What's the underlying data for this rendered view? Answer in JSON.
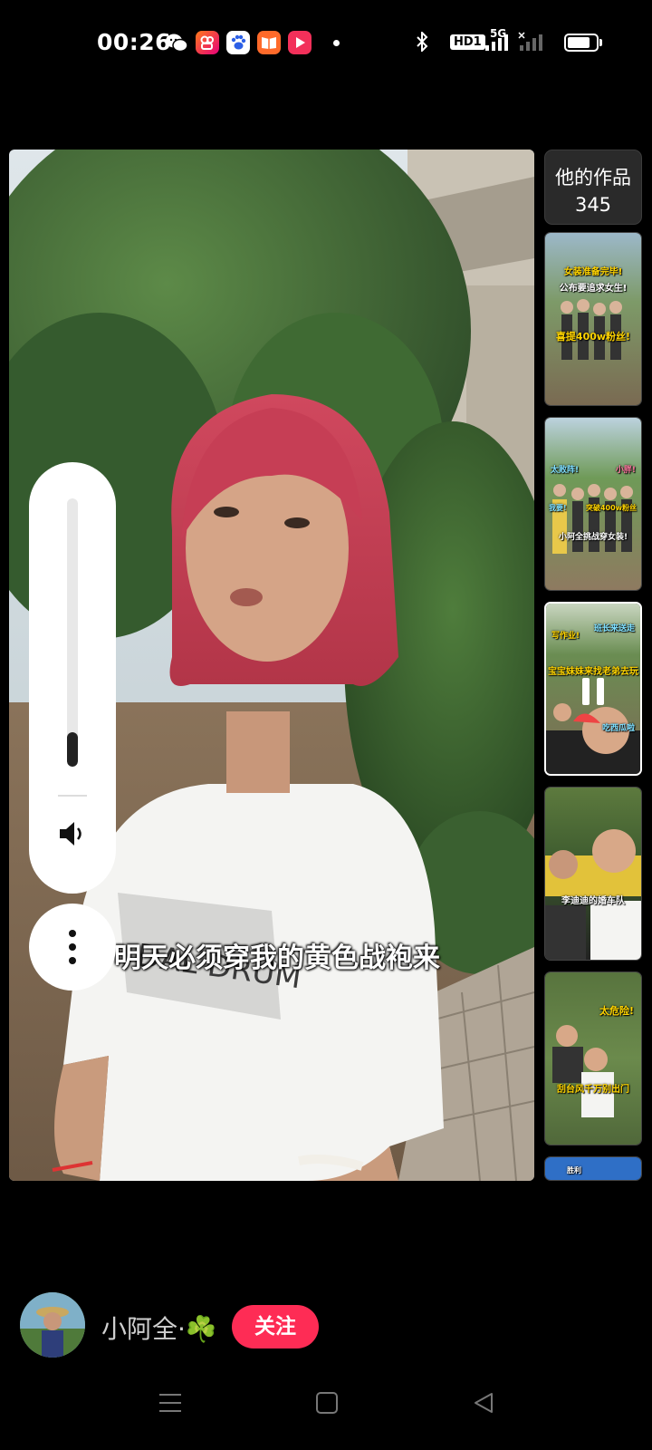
{
  "status_bar": {
    "time": "00:26",
    "apps": [
      "wechat-icon",
      "kuaishou-icon",
      "baidu-icon",
      "reader-icon",
      "video-app-icon"
    ],
    "hd_label": "HD1",
    "network_label": "5G",
    "battery_level": 0.8
  },
  "video": {
    "subtitle": "明天必须穿我的黄色战袍来",
    "volume_level": 0.13
  },
  "works": {
    "title": "他的作品",
    "count": "345",
    "thumbnails": [
      {
        "lines": [
          "女装准备完毕!",
          "公布要追求女生!",
          "喜提400w粉丝!"
        ]
      },
      {
        "lines": [
          "太败阵!",
          "小胖!",
          "突破400w粉丝",
          "我要!",
          "小阿全挑战穿女装!"
        ]
      },
      {
        "lines": [
          "写作业!",
          "班长来送走",
          "宝宝妹妹来找老弟去玩",
          "吃西瓜啦"
        ]
      },
      {
        "lines": [
          "李迪迪的婚车队"
        ]
      },
      {
        "lines": [
          "太危险!",
          "刮台风千万别出门"
        ]
      },
      {
        "lines": [
          "胜利"
        ]
      }
    ]
  },
  "author": {
    "name": "小阿全·",
    "emoji": "☘️",
    "follow_label": "关注"
  },
  "nav": {
    "icons": [
      "menu-icon",
      "home-icon",
      "back-icon"
    ]
  }
}
